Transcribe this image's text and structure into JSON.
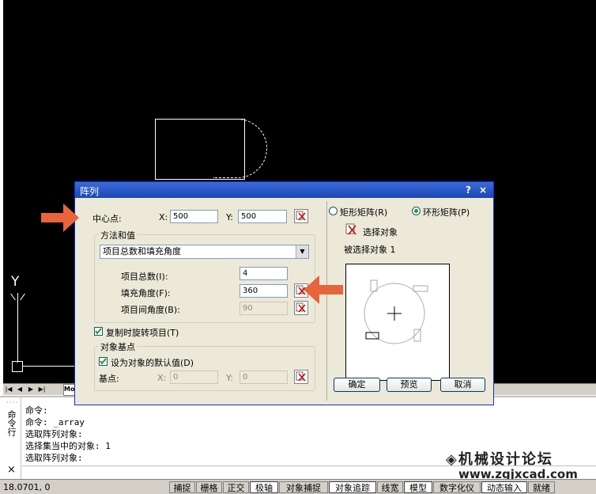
{
  "dialog": {
    "title": "阵列",
    "help": "?",
    "close": "×",
    "rect_array_label": "矩形矩阵(R)",
    "polar_array_label": "环形矩阵(P)",
    "select_objects_label": "选择对象",
    "selected_count_text": "被选择对象 1",
    "center_point_label": "中心点:",
    "x_label": "X:",
    "y_label": "Y:",
    "center_x": "500",
    "center_y": "500",
    "method_group_label": "方法和值",
    "method_value": "项目总数和填充角度",
    "total_items_label": "项目总数(I):",
    "total_items_value": "4",
    "fill_angle_label": "填充角度(F):",
    "fill_angle_value": "360",
    "item_angle_label": "项目间角度(B):",
    "item_angle_value": "90",
    "rotate_label": "复制时旋转项目(T)",
    "base_group_label": "对象基点",
    "default_base_label": "设为对象的默认值(D)",
    "base_point_label": "基点:",
    "base_x": "0",
    "base_y": "0",
    "ok": "确定",
    "preview": "预览",
    "cancel": "取消"
  },
  "command": {
    "side_label": "命令行",
    "lines": [
      "命令:",
      "命令: _array",
      "选取阵列对象:",
      "选择集当中的对象: 1",
      "选取阵列对象:"
    ],
    "close": "×"
  },
  "tabs": {
    "model": "Mo"
  },
  "ucs": {
    "y": "Y"
  },
  "status": {
    "coords": "18.0701, 0",
    "buttons": [
      "捕捉",
      "栅格",
      "正交",
      "极轴",
      "对象捕捉",
      "对象追踪",
      "线宽",
      "模型",
      "数字化仪",
      "动态输入",
      "就绪"
    ]
  },
  "watermark": {
    "text": "◈机械设计论坛",
    "url": "www.zgjxcad.com"
  },
  "colors": {
    "arrow": "#e8643a",
    "titlebar": "#1c47b5"
  }
}
